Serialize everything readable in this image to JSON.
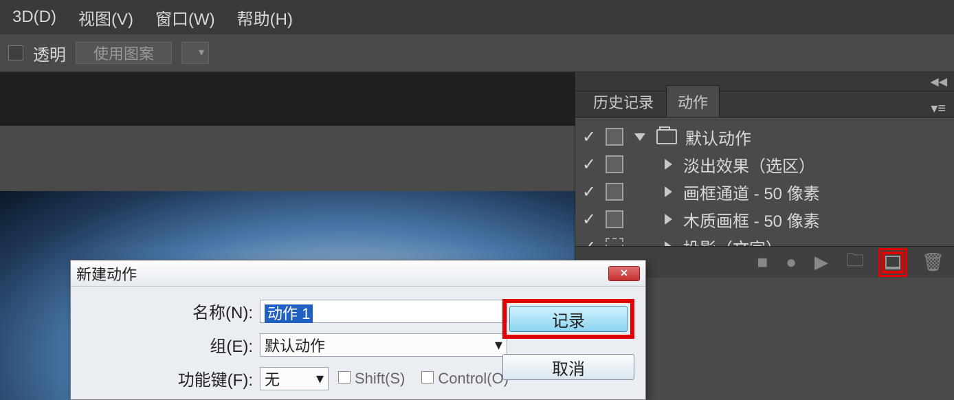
{
  "menubar": {
    "items": [
      "3D(D)",
      "视图(V)",
      "窗口(W)",
      "帮助(H)"
    ]
  },
  "toolbar": {
    "transparent": "透明",
    "usepattern": "使用图案"
  },
  "panel": {
    "tabs": {
      "history": "历史记录",
      "actions": "动作"
    },
    "set": "默认动作",
    "items": [
      "淡出效果（选区）",
      "画框通道 - 50 像素",
      "木质画框 - 50 像素",
      "投影（文字）"
    ]
  },
  "dialog": {
    "title": "新建动作",
    "labels": {
      "name": "名称(N):",
      "group": "组(E):",
      "fkey": "功能键(F):"
    },
    "name_value": "动作 1",
    "group_value": "默认动作",
    "fkey_value": "无",
    "shift": "Shift(S)",
    "ctrl": "Control(O)",
    "record": "记录",
    "cancel": "取消"
  }
}
